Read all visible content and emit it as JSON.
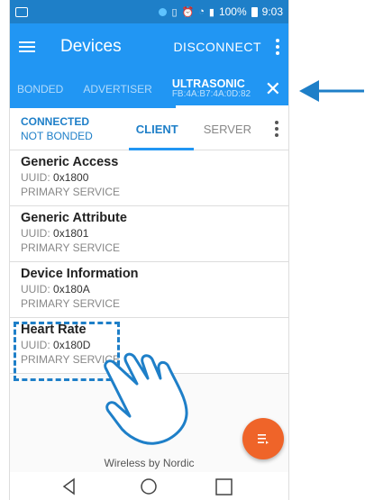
{
  "status_bar": {
    "battery": "100%",
    "time": "9:03"
  },
  "app_bar": {
    "title": "Devices",
    "disconnect_label": "DISCONNECT"
  },
  "device_tabs": {
    "items": [
      "BONDED",
      "ADVERTISER"
    ],
    "active": {
      "name": "ULTRASONIC",
      "address": "FB:4A:B7:4A:0D:82"
    }
  },
  "connection": {
    "state": "CONNECTED",
    "bond": "NOT BONDED"
  },
  "sub_tabs": {
    "client": "CLIENT",
    "server": "SERVER"
  },
  "uuid_label": "UUID:",
  "services": [
    {
      "name": "Generic Access",
      "uuid": "0x1800",
      "type": "PRIMARY SERVICE"
    },
    {
      "name": "Generic Attribute",
      "uuid": "0x1801",
      "type": "PRIMARY SERVICE"
    },
    {
      "name": "Device Information",
      "uuid": "0x180A",
      "type": "PRIMARY SERVICE"
    },
    {
      "name": "Heart Rate",
      "uuid": "0x180D",
      "type": "PRIMARY SERVICE"
    }
  ],
  "footer": "Wireless by Nordic",
  "colors": {
    "status_bar": "#1e7fc8",
    "primary": "#2196f3",
    "accent": "#ef6429",
    "highlight": "#1e7fc8"
  }
}
